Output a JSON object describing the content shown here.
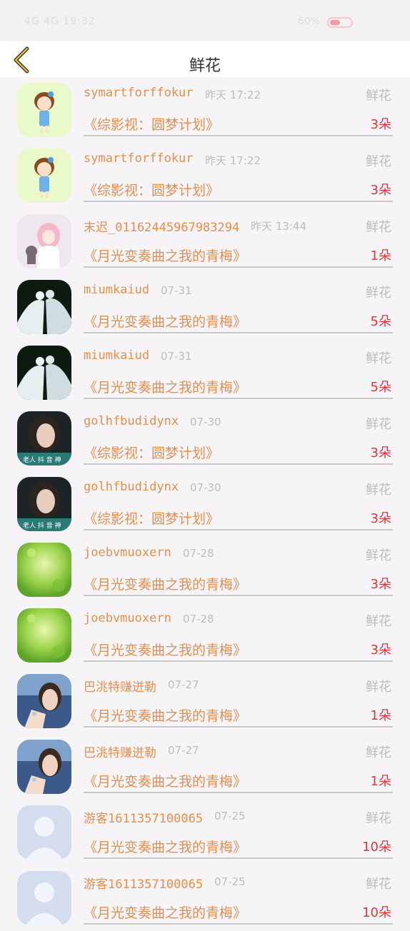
{
  "status_bar": {
    "left_text": "4G 4G 19:32",
    "right_text": "60%"
  },
  "header": {
    "title": "鲜花"
  },
  "items": [
    {
      "user": "symartforffokur",
      "time": "昨天 17:22",
      "label": "鲜花",
      "book": "《综影视：圆梦计划》",
      "qty": "3朵",
      "avatar": "girl-cartoon"
    },
    {
      "user": "symartforffokur",
      "time": "昨天 17:22",
      "label": "鲜花",
      "book": "《综影视：圆梦计划》",
      "qty": "3朵",
      "avatar": "girl-cartoon"
    },
    {
      "user": "末迟_01162445967983294",
      "time": "昨天 13:44",
      "label": "鲜花",
      "book": "《月光变奏曲之我的青梅》",
      "qty": "1朵",
      "avatar": "anime-illustration"
    },
    {
      "user": "miumkaiud",
      "time": "07-31",
      "label": "鲜花",
      "book": "《月光变奏曲之我的青梅》",
      "qty": "5朵",
      "avatar": "doves-photo"
    },
    {
      "user": "miumkaiud",
      "time": "07-31",
      "label": "鲜花",
      "book": "《月光变奏曲之我的青梅》",
      "qty": "5朵",
      "avatar": "doves-photo"
    },
    {
      "user": "golhfbudidynx",
      "time": "07-30",
      "label": "鲜花",
      "book": "《综影视：圆梦计划》",
      "qty": "3朵",
      "avatar": "woman-photo"
    },
    {
      "user": "golhfbudidynx",
      "time": "07-30",
      "label": "鲜花",
      "book": "《综影视：圆梦计划》",
      "qty": "3朵",
      "avatar": "woman-photo"
    },
    {
      "user": "joebvmuoxern",
      "time": "07-28",
      "label": "鲜花",
      "book": "《月光变奏曲之我的青梅》",
      "qty": "3朵",
      "avatar": "green-bokeh"
    },
    {
      "user": "joebvmuoxern",
      "time": "07-28",
      "label": "鲜花",
      "book": "《月光变奏曲之我的青梅》",
      "qty": "3朵",
      "avatar": "green-bokeh"
    },
    {
      "user": "巴洮特赚迸勒",
      "time": "07-27",
      "label": "鲜花",
      "book": "《月光变奏曲之我的青梅》",
      "qty": "1朵",
      "avatar": "man-photo"
    },
    {
      "user": "巴洮特赚迸勒",
      "time": "07-27",
      "label": "鲜花",
      "book": "《月光变奏曲之我的青梅》",
      "qty": "1朵",
      "avatar": "man-photo"
    },
    {
      "user": "游客1611357100065",
      "time": "07-25",
      "label": "鲜花",
      "book": "《月光变奏曲之我的青梅》",
      "qty": "10朵",
      "avatar": "default-avatar"
    },
    {
      "user": "游客1611357100065",
      "time": "07-25",
      "label": "鲜花",
      "book": "《月光变奏曲之我的青梅》",
      "qty": "10朵",
      "avatar": "default-avatar"
    }
  ]
}
